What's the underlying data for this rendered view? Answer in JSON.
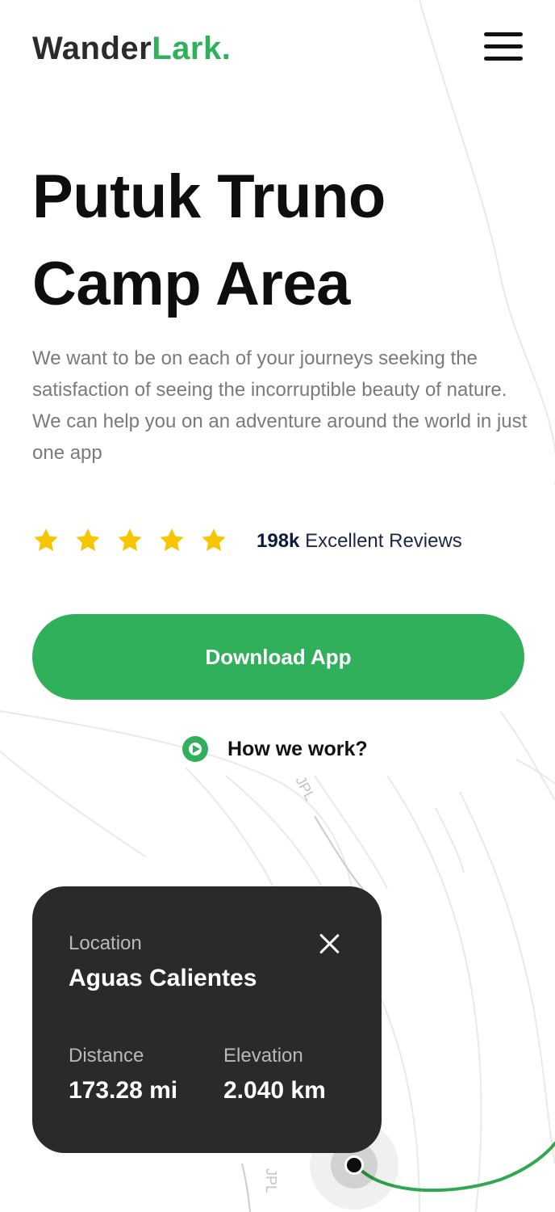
{
  "brand": {
    "part1": "Wander",
    "part2": "Lark."
  },
  "header": {
    "menu_icon": "hamburger-menu-icon"
  },
  "hero": {
    "title": "Putuk Truno Camp Area",
    "description": "We want to be on each of your journeys seeking the satisfaction of seeing the incorruptible beauty of nature. We can help you on an adventure around the world in just one app"
  },
  "rating": {
    "stars": 5,
    "star_icon": "star-icon",
    "count": "198k",
    "label": "Excellent Reviews"
  },
  "cta": {
    "download_label": "Download App",
    "how_label": "How we work?",
    "how_icon": "play-circle-icon"
  },
  "map": {
    "contour_labels": [
      "JPL",
      "JPL"
    ],
    "location_card": {
      "location_label": "Location",
      "location_value": "Aguas Calientes",
      "distance_label": "Distance",
      "distance_value": "173.28 mi",
      "elevation_label": "Elevation",
      "elevation_value": "2.040 km",
      "close_icon": "close-icon"
    },
    "pin_icon": "map-pin-icon"
  },
  "colors": {
    "accent": "#31b05b",
    "text_dark": "#0e0e0e",
    "text_muted": "#7a7a7a",
    "review_text": "#1b2748",
    "star": "#f7c600",
    "card_bg": "#2a2a28",
    "route": "#2fa84f"
  }
}
